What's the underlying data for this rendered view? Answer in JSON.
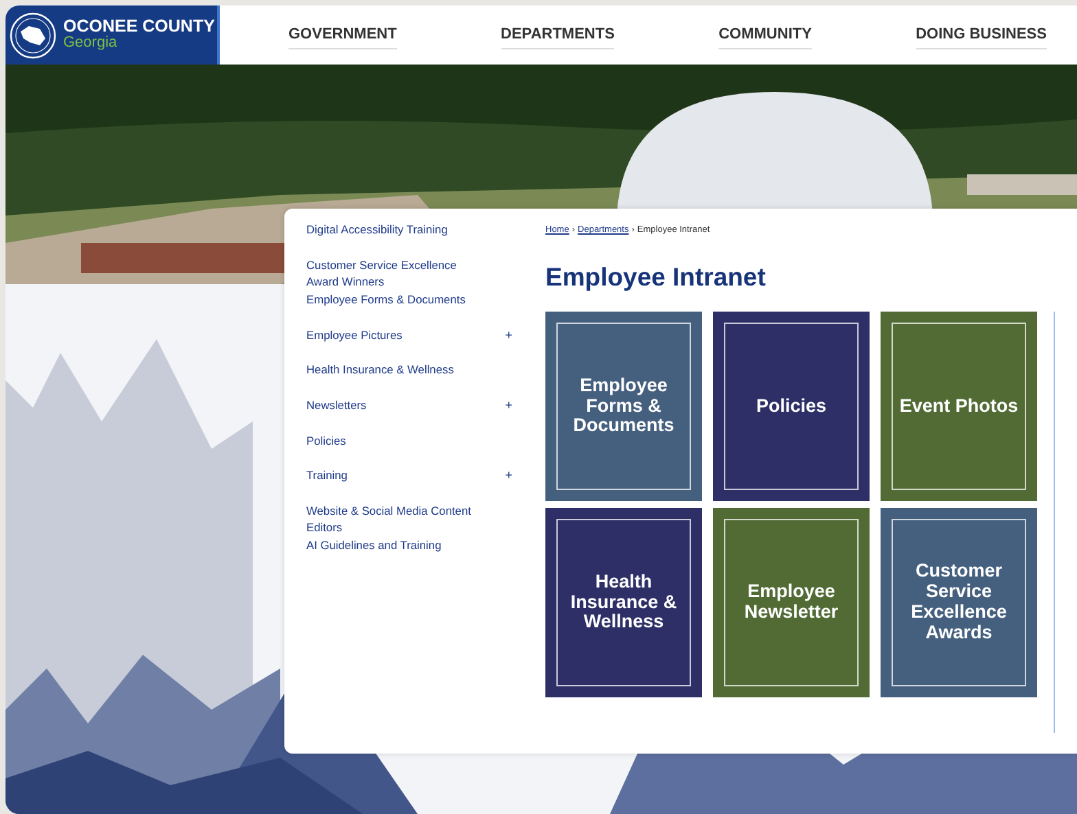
{
  "logo": {
    "name": "OCONEE COUNTY",
    "subtitle": "Georgia"
  },
  "nav": [
    {
      "label": "GOVERNMENT"
    },
    {
      "label": "DEPARTMENTS"
    },
    {
      "label": "COMMUNITY"
    },
    {
      "label": "DOING BUSINESS"
    }
  ],
  "sidebar": {
    "items": [
      {
        "label": "Digital Accessibility Training"
      },
      {
        "label": "Customer Service Excellence Award Winners"
      },
      {
        "label": "Employee Forms & Documents"
      },
      {
        "label": "Employee Pictures",
        "expand_icon": "+"
      },
      {
        "label": "Health Insurance & Wellness"
      },
      {
        "label": "Newsletters",
        "expand_icon": "+"
      },
      {
        "label": "Policies"
      },
      {
        "label": "Training",
        "expand_icon": "+"
      },
      {
        "label": "Website & Social Media Content Editors"
      },
      {
        "label": "AI Guidelines and Training"
      }
    ]
  },
  "breadcrumb": [
    {
      "label": "Home",
      "link": true
    },
    {
      "label": "Departments",
      "link": true
    },
    {
      "label": "Employee Intranet",
      "link": false
    }
  ],
  "breadcrumb_separator": "›",
  "title": "Employee Intranet",
  "tiles": [
    {
      "label": "Employee Forms & Documents",
      "color": "#45607f"
    },
    {
      "label": "Policies",
      "color": "#2d2f66"
    },
    {
      "label": "Event Photos",
      "color": "#526b35"
    },
    {
      "label": "Health Insurance & Wellness",
      "color": "#2d2f66"
    },
    {
      "label": "Employee Newsletter",
      "color": "#526b35"
    },
    {
      "label": "Customer Service Excellence Awards",
      "color": "#45607f"
    }
  ]
}
